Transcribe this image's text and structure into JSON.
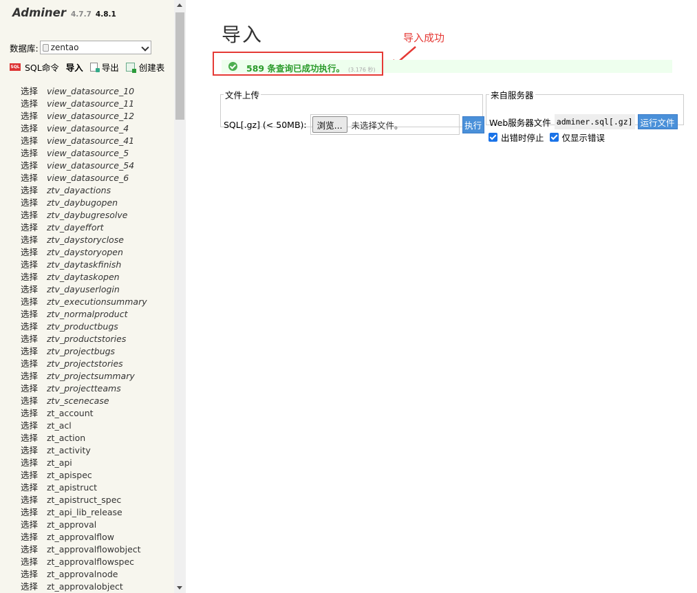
{
  "brand": {
    "name": "Adminer",
    "old_version": "4.7.7",
    "new_version": "4.8.1"
  },
  "db": {
    "label": "数据库:",
    "selected": "zentao"
  },
  "menu": {
    "sql": "SQL命令",
    "sql_icon": "SQL",
    "import": "导入",
    "export": "导出",
    "create": "创建表"
  },
  "tables": [
    {
      "sel": "选择",
      "name": "view_datasource_10",
      "view": true
    },
    {
      "sel": "选择",
      "name": "view_datasource_11",
      "view": true
    },
    {
      "sel": "选择",
      "name": "view_datasource_12",
      "view": true
    },
    {
      "sel": "选择",
      "name": "view_datasource_4",
      "view": true
    },
    {
      "sel": "选择",
      "name": "view_datasource_41",
      "view": true
    },
    {
      "sel": "选择",
      "name": "view_datasource_5",
      "view": true
    },
    {
      "sel": "选择",
      "name": "view_datasource_54",
      "view": true
    },
    {
      "sel": "选择",
      "name": "view_datasource_6",
      "view": true
    },
    {
      "sel": "选择",
      "name": "ztv_dayactions",
      "view": true
    },
    {
      "sel": "选择",
      "name": "ztv_daybugopen",
      "view": true
    },
    {
      "sel": "选择",
      "name": "ztv_daybugresolve",
      "view": true
    },
    {
      "sel": "选择",
      "name": "ztv_dayeffort",
      "view": true
    },
    {
      "sel": "选择",
      "name": "ztv_daystoryclose",
      "view": true
    },
    {
      "sel": "选择",
      "name": "ztv_daystoryopen",
      "view": true
    },
    {
      "sel": "选择",
      "name": "ztv_daytaskfinish",
      "view": true
    },
    {
      "sel": "选择",
      "name": "ztv_daytaskopen",
      "view": true
    },
    {
      "sel": "选择",
      "name": "ztv_dayuserlogin",
      "view": true
    },
    {
      "sel": "选择",
      "name": "ztv_executionsummary",
      "view": true
    },
    {
      "sel": "选择",
      "name": "ztv_normalproduct",
      "view": true
    },
    {
      "sel": "选择",
      "name": "ztv_productbugs",
      "view": true
    },
    {
      "sel": "选择",
      "name": "ztv_productstories",
      "view": true
    },
    {
      "sel": "选择",
      "name": "ztv_projectbugs",
      "view": true
    },
    {
      "sel": "选择",
      "name": "ztv_projectstories",
      "view": true
    },
    {
      "sel": "选择",
      "name": "ztv_projectsummary",
      "view": true
    },
    {
      "sel": "选择",
      "name": "ztv_projectteams",
      "view": true
    },
    {
      "sel": "选择",
      "name": "ztv_scenecase",
      "view": true
    },
    {
      "sel": "选择",
      "name": "zt_account",
      "view": false
    },
    {
      "sel": "选择",
      "name": "zt_acl",
      "view": false
    },
    {
      "sel": "选择",
      "name": "zt_action",
      "view": false
    },
    {
      "sel": "选择",
      "name": "zt_activity",
      "view": false
    },
    {
      "sel": "选择",
      "name": "zt_api",
      "view": false
    },
    {
      "sel": "选择",
      "name": "zt_apispec",
      "view": false
    },
    {
      "sel": "选择",
      "name": "zt_apistruct",
      "view": false
    },
    {
      "sel": "选择",
      "name": "zt_apistruct_spec",
      "view": false
    },
    {
      "sel": "选择",
      "name": "zt_api_lib_release",
      "view": false
    },
    {
      "sel": "选择",
      "name": "zt_approval",
      "view": false
    },
    {
      "sel": "选择",
      "name": "zt_approvalflow",
      "view": false
    },
    {
      "sel": "选择",
      "name": "zt_approvalflowobject",
      "view": false
    },
    {
      "sel": "选择",
      "name": "zt_approvalflowspec",
      "view": false
    },
    {
      "sel": "选择",
      "name": "zt_approvalnode",
      "view": false
    },
    {
      "sel": "选择",
      "name": "zt_approvalobject",
      "view": false
    }
  ],
  "page": {
    "title": "导入"
  },
  "annotation": {
    "text": "导入成功",
    "color": "#e53935"
  },
  "message": {
    "text": "589 条查询已成功执行。",
    "time": "(3.176 秒)"
  },
  "upload": {
    "legend": "文件上传",
    "label": "SQL[.gz] (< 50MB):",
    "browse": "浏览...",
    "no_file": "未选择文件。",
    "execute": "执行"
  },
  "server": {
    "legend": "来自服务器",
    "label": "Web服务器文件",
    "file": "adminer.sql[.gz]",
    "run": "运行文件"
  },
  "options": {
    "stop_on_error": "出错时停止",
    "only_errors": "仅显示错误"
  }
}
